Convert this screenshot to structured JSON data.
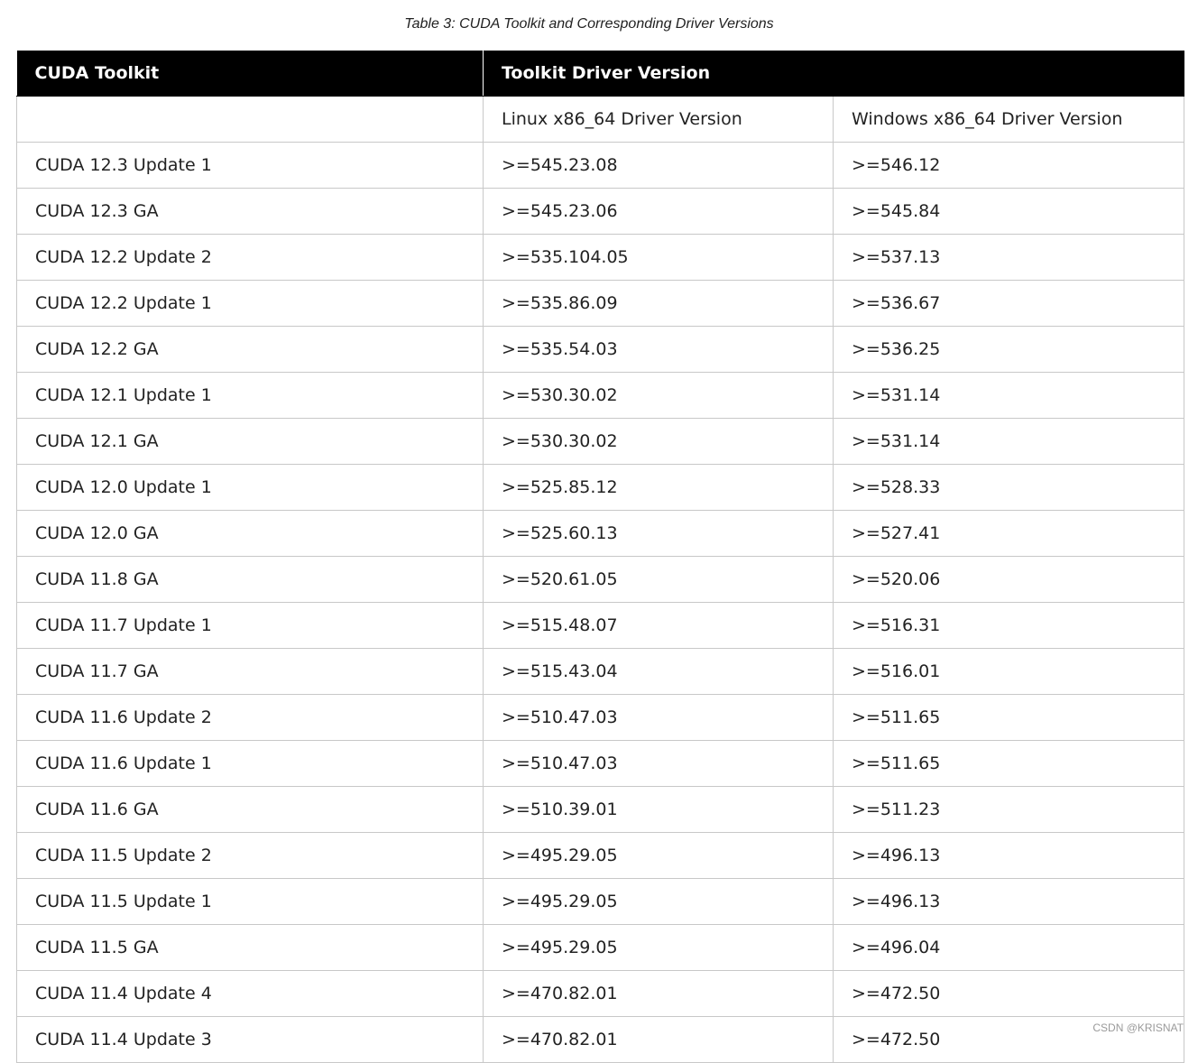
{
  "caption": "Table 3: CUDA Toolkit and Corresponding Driver Versions",
  "header": {
    "col1": "CUDA Toolkit",
    "col2": "Toolkit Driver Version"
  },
  "subheader": {
    "col1": "",
    "col2": "Linux x86_64 Driver Version",
    "col3": "Windows x86_64 Driver Version"
  },
  "rows": [
    {
      "toolkit": "CUDA 12.3 Update 1",
      "linux": ">=545.23.08",
      "windows": ">=546.12"
    },
    {
      "toolkit": "CUDA 12.3 GA",
      "linux": ">=545.23.06",
      "windows": ">=545.84"
    },
    {
      "toolkit": "CUDA 12.2 Update 2",
      "linux": ">=535.104.05",
      "windows": ">=537.13"
    },
    {
      "toolkit": "CUDA 12.2 Update 1",
      "linux": ">=535.86.09",
      "windows": ">=536.67"
    },
    {
      "toolkit": "CUDA 12.2 GA",
      "linux": ">=535.54.03",
      "windows": ">=536.25"
    },
    {
      "toolkit": "CUDA 12.1 Update 1",
      "linux": ">=530.30.02",
      "windows": ">=531.14"
    },
    {
      "toolkit": "CUDA 12.1 GA",
      "linux": ">=530.30.02",
      "windows": ">=531.14"
    },
    {
      "toolkit": "CUDA 12.0 Update 1",
      "linux": ">=525.85.12",
      "windows": ">=528.33"
    },
    {
      "toolkit": "CUDA 12.0 GA",
      "linux": ">=525.60.13",
      "windows": ">=527.41"
    },
    {
      "toolkit": "CUDA 11.8 GA",
      "linux": ">=520.61.05",
      "windows": ">=520.06"
    },
    {
      "toolkit": "CUDA 11.7 Update 1",
      "linux": ">=515.48.07",
      "windows": ">=516.31"
    },
    {
      "toolkit": "CUDA 11.7 GA",
      "linux": ">=515.43.04",
      "windows": ">=516.01"
    },
    {
      "toolkit": "CUDA 11.6 Update 2",
      "linux": ">=510.47.03",
      "windows": ">=511.65"
    },
    {
      "toolkit": "CUDA 11.6 Update 1",
      "linux": ">=510.47.03",
      "windows": ">=511.65"
    },
    {
      "toolkit": "CUDA 11.6 GA",
      "linux": ">=510.39.01",
      "windows": ">=511.23"
    },
    {
      "toolkit": "CUDA 11.5 Update 2",
      "linux": ">=495.29.05",
      "windows": ">=496.13"
    },
    {
      "toolkit": "CUDA 11.5 Update 1",
      "linux": ">=495.29.05",
      "windows": ">=496.13"
    },
    {
      "toolkit": "CUDA 11.5 GA",
      "linux": ">=495.29.05",
      "windows": ">=496.04"
    },
    {
      "toolkit": "CUDA 11.4 Update 4",
      "linux": ">=470.82.01",
      "windows": ">=472.50"
    },
    {
      "toolkit": "CUDA 11.4 Update 3",
      "linux": ">=470.82.01",
      "windows": ">=472.50"
    }
  ],
  "watermark": "CSDN @KRISNAT"
}
